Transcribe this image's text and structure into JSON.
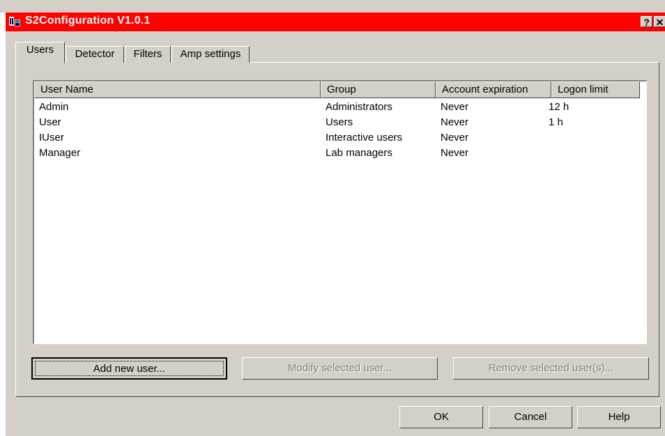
{
  "window": {
    "title": "S2Configuration V1.0.1",
    "help_glyph": "?",
    "close_glyph": "✕",
    "titlebar_color": "#ff0000"
  },
  "tabs": [
    {
      "label": "Users",
      "active": true
    },
    {
      "label": "Detector",
      "active": false
    },
    {
      "label": "Filters",
      "active": false
    },
    {
      "label": "Amp settings",
      "active": false
    }
  ],
  "users_table": {
    "columns": [
      "User Name",
      "Group",
      "Account expiration",
      "Logon limit"
    ],
    "rows": [
      [
        "Admin",
        "Administrators",
        "Never",
        "12 h"
      ],
      [
        "User",
        "Users",
        "Never",
        "1 h"
      ],
      [
        "IUser",
        "Interactive users",
        "Never",
        ""
      ],
      [
        "Manager",
        "Lab managers",
        "Never",
        ""
      ]
    ]
  },
  "panel_buttons": {
    "add": "Add new user...",
    "modify": "Modify selected user...",
    "remove": "Remove selected user(s)..."
  },
  "dialog_buttons": {
    "ok": "OK",
    "cancel": "Cancel",
    "help": "Help"
  }
}
